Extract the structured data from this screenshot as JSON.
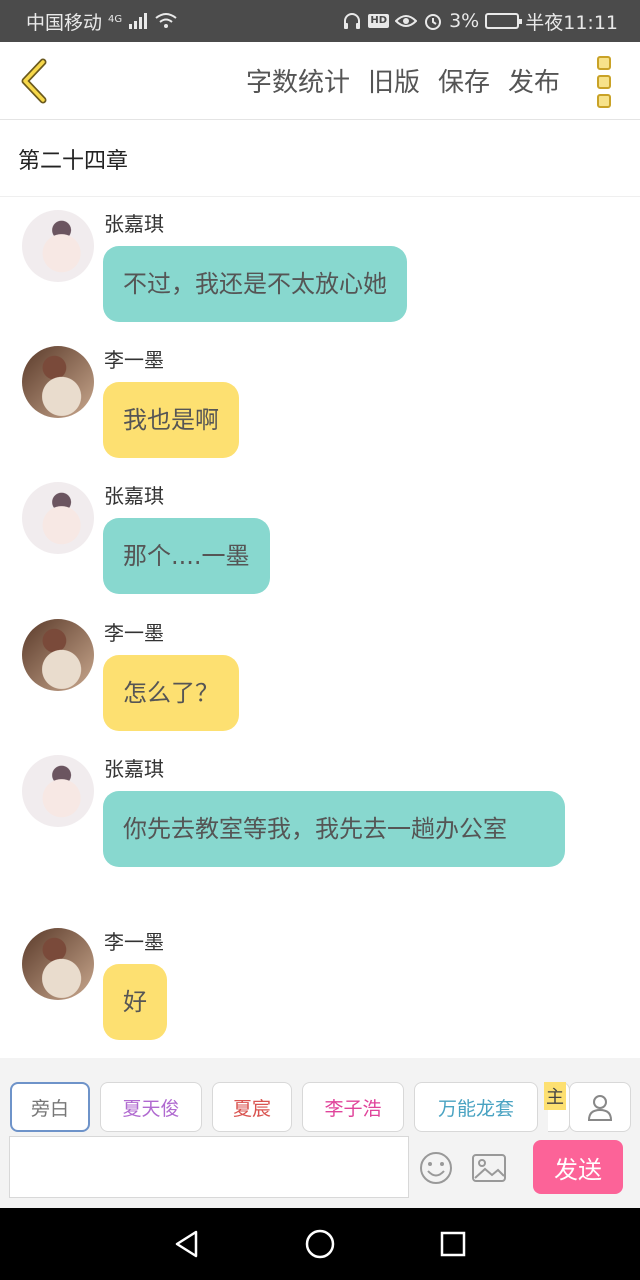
{
  "status_bar": {
    "carrier": "中国移动",
    "network": "4G",
    "battery_percent": "3%",
    "time": "半夜11:11",
    "hd_label": "HD"
  },
  "toolbar": {
    "back_icon": "chevron-left-icon",
    "actions": [
      "字数统计",
      "旧版",
      "保存",
      "发布"
    ],
    "more_icon": "more-vertical-icon",
    "accent_color": "#c9a227"
  },
  "chapter": {
    "title": "第二十四章"
  },
  "messages": [
    {
      "sender": "张嘉琪",
      "text": "不过，我还是不太放心她",
      "color": "#88d8cf"
    },
    {
      "sender": "李一墨",
      "text": "我也是啊",
      "color": "#fde071"
    },
    {
      "sender": "张嘉琪",
      "text": "那个....一墨",
      "color": "#88d8cf"
    },
    {
      "sender": "李一墨",
      "text": "怎么了？",
      "color": "#fde071"
    },
    {
      "sender": "张嘉琪",
      "text": "你先去教室等我，我先去一趟办公室",
      "color": "#88d8cf"
    },
    {
      "sender": "李一墨",
      "text": "好",
      "color": "#fde071"
    }
  ],
  "roles": [
    {
      "label": "旁白",
      "color": "#777777"
    },
    {
      "label": "夏天俊",
      "color": "#b06ad0"
    },
    {
      "label": "夏宸",
      "color": "#d9534f"
    },
    {
      "label": "李子浩",
      "color": "#e0449b"
    },
    {
      "label": "万能龙套",
      "color": "#4aa3c2"
    }
  ],
  "role_main_label": "主",
  "input": {
    "value": "",
    "placeholder": ""
  },
  "send_label": "发送",
  "send_color": "#fc6398"
}
